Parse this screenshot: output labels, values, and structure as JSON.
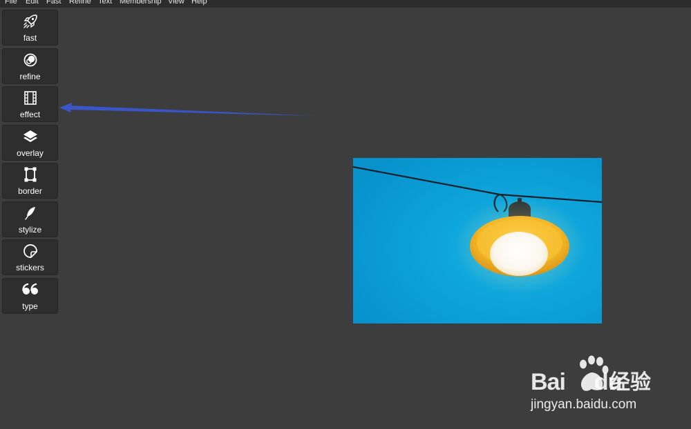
{
  "menu": {
    "items": [
      {
        "label": "File"
      },
      {
        "label": "Edit"
      },
      {
        "label": "Fast"
      },
      {
        "label": "Refine"
      },
      {
        "label": "Text"
      },
      {
        "label": "Membership"
      },
      {
        "label": "View"
      },
      {
        "label": "Help"
      }
    ]
  },
  "tools": [
    {
      "label": "fast",
      "icon": "rocket-icon"
    },
    {
      "label": "refine",
      "icon": "refine-circles-icon"
    },
    {
      "label": "effect",
      "icon": "film-icon"
    },
    {
      "label": "overlay",
      "icon": "layers-icon"
    },
    {
      "label": "border",
      "icon": "border-frame-icon"
    },
    {
      "label": "stylize",
      "icon": "feather-icon"
    },
    {
      "label": "stickers",
      "icon": "sticker-icon"
    },
    {
      "label": "type",
      "icon": "quote-icon"
    }
  ],
  "colors": {
    "background": "#3d3d3d",
    "menubar": "#2c2c2c",
    "tool_button": "#2e2e2e",
    "annotation_arrow": "#3a55c8",
    "photo_sky": "#0aa0d6",
    "lamp_shade": "#f0b21e"
  },
  "watermark": {
    "brand": "Bai",
    "brand_suffix": "du",
    "product": "经验",
    "url": "jingyan.baidu.com"
  }
}
